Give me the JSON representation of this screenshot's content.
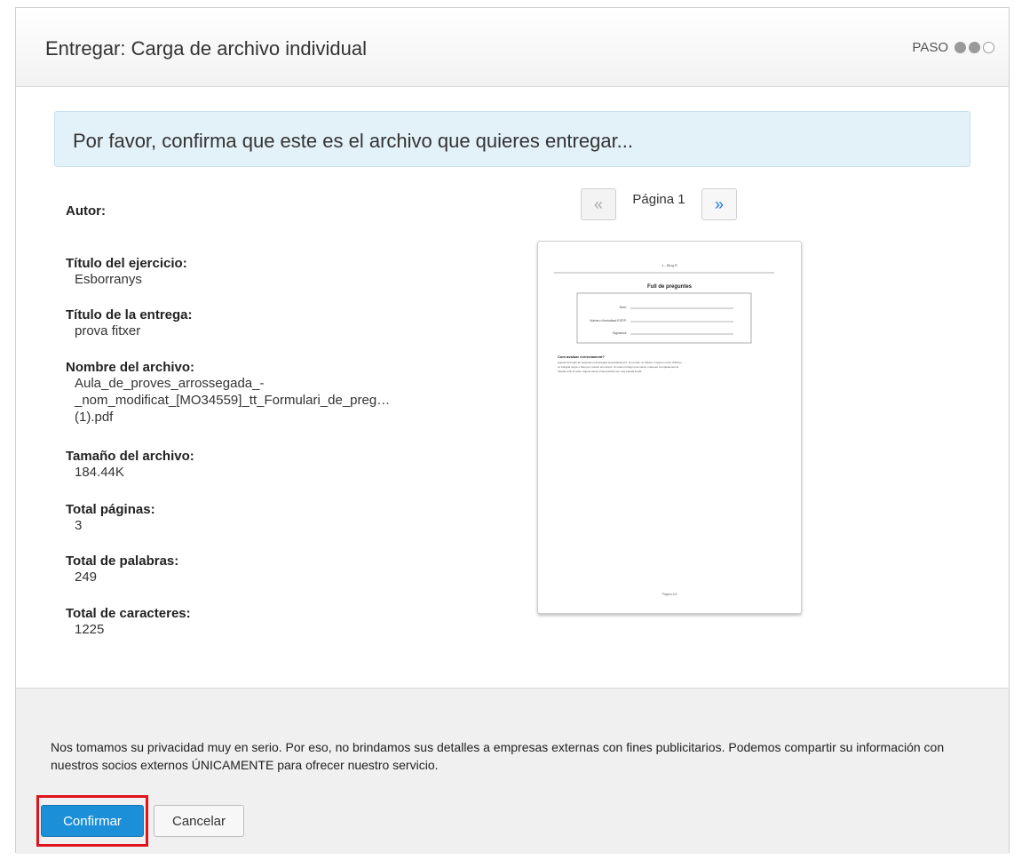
{
  "header": {
    "title": "Entregar: Carga de archivo individual",
    "step_label": "PASO"
  },
  "banner": {
    "text": "Por favor, confirma que este es el archivo que quieres entregar..."
  },
  "details": [
    {
      "label": "Autor:",
      "value": ""
    },
    {
      "label": "Título del ejercicio:",
      "value": "Esborranys"
    },
    {
      "label": "Título de la entrega:",
      "value": "prova fitxer"
    },
    {
      "label": "Nombre del archivo:",
      "value_lines": [
        "Aula_de_proves_arrossegada_-",
        "_nom_modificat_[MO34559]_tt_Formulari_de_preg…",
        "(1).pdf"
      ]
    },
    {
      "label": "Tamaño del archivo:",
      "value": "184.44K"
    },
    {
      "label": "Total páginas:",
      "value": "3"
    },
    {
      "label": "Total de palabras:",
      "value": "249"
    },
    {
      "label": "Total de caracteres:",
      "value": "1225"
    }
  ],
  "pager": {
    "prev": "«",
    "label": "Página 1",
    "next": "»"
  },
  "preview": {
    "header_text": "1 - Blog R",
    "title": "Full de preguntes",
    "fields": [
      "Nom:",
      "Número d'estudiant EGPP:",
      "Signatura:"
    ],
    "section_title": "Com avaluar correctament?",
    "body_lines": [
      "Aquest formulari de resposta s'escanejarà automàticament. Si us plau no dobleu o taqueu el full. Utilitzeu",
      "un bolígraf negre o blau per marcar els camps. Si voleu corregir una marca, marqueu completament la",
      "casella amb el color. Aquest camp s'interpretarà com una casella buida."
    ],
    "footer_text": "Pàgina 1/3"
  },
  "footer": {
    "privacy": "Nos tomamos su privacidad muy en serio. Por eso, no brindamos sus detalles a empresas externas con fines publicitarios. Podemos compartir su información con nuestros socios externos ÚNICAMENTE para ofrecer nuestro servicio.",
    "confirm_label": "Confirmar",
    "cancel_label": "Cancelar"
  },
  "colors": {
    "primary": "#1b8fd8",
    "highlight": "#e0141e",
    "banner_bg": "#e3f1f8"
  },
  "steps": {
    "current": 2,
    "total": 3
  }
}
